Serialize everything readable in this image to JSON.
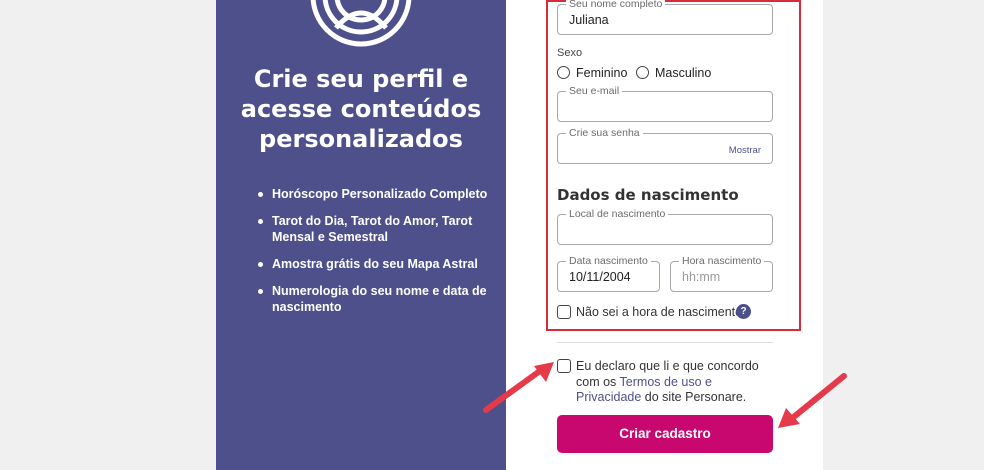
{
  "brand": {
    "panel_color": "#4d508a",
    "accent_color": "#c8086e",
    "highlight_color": "#d92c3b",
    "logo_icon": "personare-logo-icon"
  },
  "left": {
    "headline": "Crie seu perfil e acesse conteúdos personalizados",
    "benefits": [
      "Horóscopo Personalizado Completo",
      "Tarot do Dia, Tarot do Amor, Tarot Mensal e Semestral",
      "Amostra grátis do seu Mapa Astral",
      "Numerologia do seu nome e data de nascimento"
    ]
  },
  "form": {
    "name": {
      "label": "Seu nome completo",
      "value": "Juliana"
    },
    "sex": {
      "label": "Sexo",
      "options": [
        "Feminino",
        "Masculino"
      ]
    },
    "email": {
      "label": "Seu e-mail",
      "value": ""
    },
    "password": {
      "label": "Crie sua senha",
      "value": "",
      "show_label": "Mostrar"
    },
    "birth_section_title": "Dados de nascimento",
    "birthplace": {
      "label": "Local de nascimento",
      "value": ""
    },
    "birth_date": {
      "label": "Data nascimento",
      "value": "10/11/2004"
    },
    "birth_time": {
      "label": "Hora nascimento",
      "placeholder": "hh:mm"
    },
    "unknown_time": {
      "label": "Não sei a hora de nascimento",
      "help": "?"
    },
    "terms": {
      "text_before": "Eu declaro que li e que concordo com os ",
      "link": "Termos de uso e Privacidade",
      "text_after": " do site Personare."
    },
    "submit_label": "Criar cadastro"
  }
}
